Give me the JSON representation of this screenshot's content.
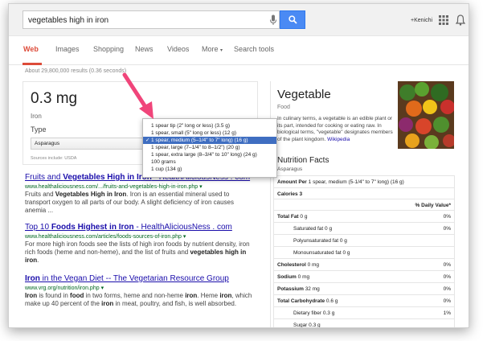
{
  "search": {
    "query": "vegetables high in iron"
  },
  "header": {
    "user": "+Kenichi"
  },
  "tabs": [
    {
      "label": "Web"
    },
    {
      "label": "Images"
    },
    {
      "label": "Shopping"
    },
    {
      "label": "News"
    },
    {
      "label": "Videos"
    },
    {
      "label": "More"
    },
    {
      "label": "Search tools"
    }
  ],
  "stats": "About 29,800,000 results (0.36 seconds)",
  "converter": {
    "value": "0.3 mg",
    "unit": "Iron",
    "type_label": "Type",
    "selected": "Asparagus",
    "source": "Sources include: USDA",
    "options": [
      "1 spear tip (2\" long or less) (3.5 g)",
      "1 spear, small (5\" long or less) (12 g)",
      "1 spear, medium (5–1/4\" to 7\" long) (16 g)",
      "1 spear, large (7–1/4\" to 8–1/2\") (20 g)",
      "1 spear, extra large (8–3/4\" to 10\" long) (24 g)",
      "100 grams",
      "1 cup (134 g)"
    ],
    "selected_option": "1 spear, medium (5–1/4\" to 7\" long) (16 g)"
  },
  "results": [
    {
      "title_parts": [
        "Fruits and ",
        "Vegetables High in Iron",
        " - HealthAliciousNess . com"
      ],
      "url": "www.healthaliciousness.com/.../fruits-and-vegetables-high-in-iron.php",
      "snippet_parts": [
        "Fruits and ",
        "Vegetables High in Iron",
        ". Iron is an essential mineral used to transport oxygen to all parts of our body. A slight deficiency of iron causes anemia ..."
      ]
    },
    {
      "title_parts": [
        "Top 10 ",
        "Foods Highest in Iron",
        " - HealthAliciousNess . com"
      ],
      "url": "www.healthaliciousness.com/articles/foods-sources-of-iron.php",
      "snippet_parts": [
        "For more high iron foods see the lists of high iron foods by nutrient density, iron rich foods (heme and non-heme), and the list of fruits and ",
        "vegetables high in iron",
        "."
      ]
    },
    {
      "title_parts": [
        "Iron",
        " in the Vegan Diet -- The Vegetarian Resource Group"
      ],
      "url": "www.vrg.org/nutrition/iron.php",
      "snippet_parts": [
        "Iron",
        " is found in ",
        "food",
        " in two forms, heme and non-heme ",
        "iron",
        ". Heme ",
        "iron",
        ", which make up 40 percent of the ",
        "iron",
        " in meat, poultry, and fish, is well absorbed."
      ]
    }
  ],
  "knowledge_panel": {
    "title": "Vegetable",
    "subtitle": "Food",
    "description_visible": "In culinary terms, a vegetable is an edible plant or its part, intended for cooking or eating raw. In biological terms, \"vegetable\" designates members of the plant kingdom.",
    "wiki": "Wikipedia",
    "nutrition_title": "Nutrition Facts",
    "nutrition_sub": "Asparagus",
    "amount_label": "Amount Per",
    "amount_value": "1 spear, medium (5-1/4\" to 7\" long) (16 g)",
    "calories": "Calories 3",
    "dv_header": "% Daily Value*",
    "rows": [
      {
        "label": "Total Fat",
        "value": "0 g",
        "dv": "0%",
        "bold": true,
        "indent": 0
      },
      {
        "label": "Saturated fat",
        "value": "0 g",
        "dv": "0%",
        "bold": false,
        "indent": 1
      },
      {
        "label": "Polyunsaturated fat",
        "value": "0 g",
        "dv": "",
        "bold": false,
        "indent": 1
      },
      {
        "label": "Monounsaturated fat",
        "value": "0 g",
        "dv": "",
        "bold": false,
        "indent": 1
      },
      {
        "label": "Cholesterol",
        "value": "0 mg",
        "dv": "0%",
        "bold": true,
        "indent": 0
      },
      {
        "label": "Sodium",
        "value": "0 mg",
        "dv": "0%",
        "bold": true,
        "indent": 0
      },
      {
        "label": "Potassium",
        "value": "32 mg",
        "dv": "0%",
        "bold": true,
        "indent": 0
      },
      {
        "label": "Total Carbohydrate",
        "value": "0.6 g",
        "dv": "0%",
        "bold": true,
        "indent": 0
      },
      {
        "label": "Dietary fiber",
        "value": "0.3 g",
        "dv": "1%",
        "bold": false,
        "indent": 1
      },
      {
        "label": "Sugar",
        "value": "0.3 g",
        "dv": "",
        "bold": false,
        "indent": 1
      }
    ]
  },
  "colors": {
    "accent": "#dd4b39",
    "link": "#1a0dab",
    "url": "#006621",
    "search_blue": "#4a8af4",
    "arrow": "#f0457a"
  }
}
